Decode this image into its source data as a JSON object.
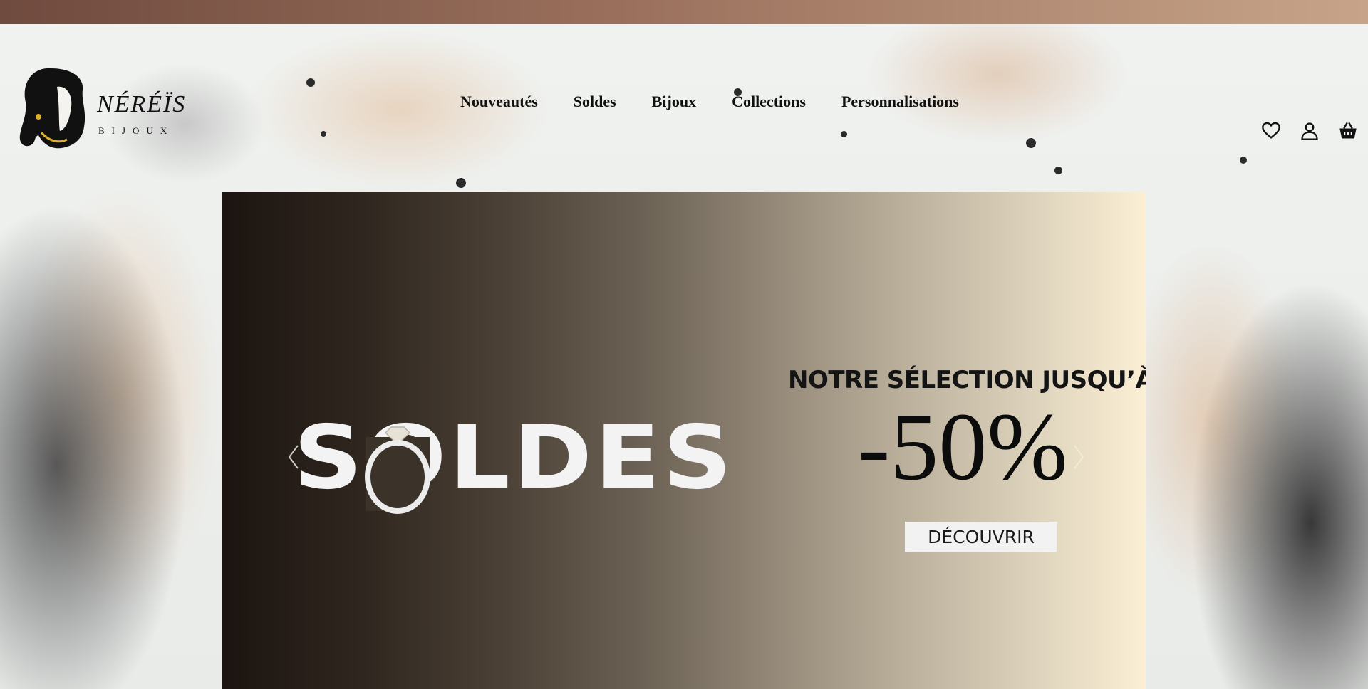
{
  "logo": {
    "text": "NÉRÉÏS",
    "sub": "BIJOUX"
  },
  "nav": {
    "items": [
      "Nouveautés",
      "Soldes",
      "Bijoux",
      "Collections",
      "Personnalisations"
    ]
  },
  "header_icons": [
    "heart-icon",
    "user-icon",
    "basket-icon"
  ],
  "banner": {
    "title": "SOLDES",
    "headline": "NOTRE SÉLECTION JUSQU’À",
    "discount": "-50%",
    "cta": "DÉCOUVRIR",
    "colors": {
      "gradient_start": "#1c1410",
      "gradient_end": "#fbefd4"
    }
  },
  "colors": {
    "topbar_start": "#6f4a3e",
    "topbar_end": "#c7a489"
  }
}
